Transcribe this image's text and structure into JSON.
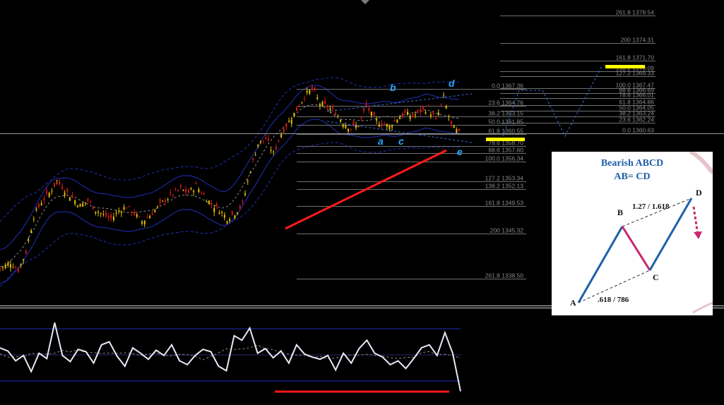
{
  "chart_data": {
    "type": "line",
    "title": "",
    "xlabel": "",
    "ylabel": "",
    "ylim": [
      1337.5,
      1380.0
    ],
    "grid": false,
    "fibonacci_levels_upper": [
      {
        "label": "261.8 1378.54",
        "value": 1378.54
      },
      {
        "label": "200 1374.31",
        "value": 1374.31
      },
      {
        "label": "161.8 1371.70",
        "value": 1371.7
      },
      {
        "label": "138.2 1370.09",
        "value": 1370.09
      },
      {
        "label": "127.2 1369.33",
        "value": 1369.33
      },
      {
        "label": "100.0 1367.47",
        "value": 1367.47
      },
      {
        "label": "88.6 1366.69",
        "value": 1366.69
      },
      {
        "label": "78.6 1366.01",
        "value": 1366.01
      },
      {
        "label": "61.8 1364.86",
        "value": 1364.86
      },
      {
        "label": "50.0 1364.05",
        "value": 1364.05
      },
      {
        "label": "38.2 1363.24",
        "value": 1363.24
      },
      {
        "label": "23.6 1362.24",
        "value": 1362.24
      },
      {
        "label": "0.0 1360.63",
        "value": 1360.63
      }
    ],
    "fibonacci_levels_lower": [
      {
        "label": "0.0 1367.36",
        "value": 1367.36
      },
      {
        "label": "23.6 1364.76",
        "value": 1364.76
      },
      {
        "label": "38.2 1363.15",
        "value": 1363.15
      },
      {
        "label": "50.0 1361.85",
        "value": 1361.85
      },
      {
        "label": "61.8 1360.55",
        "value": 1360.55
      },
      {
        "label": "78.6 1358.70",
        "value": 1358.7
      },
      {
        "label": "88.6 1357.60",
        "value": 1357.6
      },
      {
        "label": "100.0 1356.34",
        "value": 1356.34
      },
      {
        "label": "127.2 1353.34",
        "value": 1353.34
      },
      {
        "label": "138.2 1352.13",
        "value": 1352.13
      },
      {
        "label": "161.8 1349.53",
        "value": 1349.53
      },
      {
        "label": "200 1345.32",
        "value": 1345.32
      },
      {
        "label": "261.8 1338.50",
        "value": 1338.5
      }
    ],
    "current_price_line": 1360.63,
    "wave_labels": [
      "a",
      "b",
      "c",
      "d",
      "e"
    ],
    "price_series": [
      1340.2,
      1341.0,
      1339.8,
      1342.5,
      1348.0,
      1350.2,
      1351.5,
      1353.4,
      1352.0,
      1350.8,
      1349.6,
      1350.4,
      1349.0,
      1348.2,
      1347.6,
      1348.8,
      1349.5,
      1348.4,
      1347.2,
      1348.1,
      1349.3,
      1350.5,
      1351.4,
      1352.1,
      1351.6,
      1352.6,
      1351.2,
      1349.8,
      1349.0,
      1347.7,
      1348.5,
      1349.8,
      1355.0,
      1359.0,
      1359.8,
      1357.5,
      1360.6,
      1362.4,
      1364.2,
      1366.3,
      1367.4,
      1365.2,
      1364.6,
      1363.8,
      1362.3,
      1361.4,
      1361.9,
      1364.8,
      1362.8,
      1362.1,
      1361.7,
      1362.9,
      1363.6,
      1363.2,
      1364.0,
      1364.4,
      1362.6,
      1366.0,
      1361.8,
      1360.6
    ],
    "oscillator_series": [
      0.62,
      0.58,
      0.45,
      0.52,
      0.31,
      0.55,
      0.48,
      0.95,
      0.52,
      0.44,
      0.6,
      0.57,
      0.42,
      0.66,
      0.7,
      0.51,
      0.38,
      0.62,
      0.55,
      0.47,
      0.59,
      0.52,
      0.66,
      0.45,
      0.4,
      0.52,
      0.6,
      0.57,
      0.38,
      0.32,
      0.78,
      0.72,
      0.88,
      0.55,
      0.61,
      0.49,
      0.58,
      0.42,
      0.66,
      0.54,
      0.5,
      0.47,
      0.52,
      0.33,
      0.55,
      0.42,
      0.61,
      0.72,
      0.55,
      0.5,
      0.4,
      0.45,
      0.35,
      0.48,
      0.62,
      0.66,
      0.52,
      0.82,
      0.55,
      0.05
    ]
  },
  "inset": {
    "title_line1": "Bearish ABCD",
    "title_line2": "AB= CD",
    "label_a": "A",
    "label_b": "B",
    "label_c": "C",
    "label_d": "D",
    "ratio_bc": "1.27 / 1.618",
    "ratio_ab": ".618 / 786"
  },
  "colors": {
    "background": "#000000",
    "bull_candle": "#e8c100",
    "bear_candle": "#d01818",
    "bands": "#2030b8",
    "fib_lines": "#707070",
    "fib_text": "#8a8a8a",
    "wave_labels": "#28a8ff",
    "trend_line": "#ff1a1a",
    "highlight": "#ffff00",
    "oscillator": "#e8e8f8",
    "inset_leg": "#1f5fa8",
    "inset_retrace": "#c8286e"
  }
}
